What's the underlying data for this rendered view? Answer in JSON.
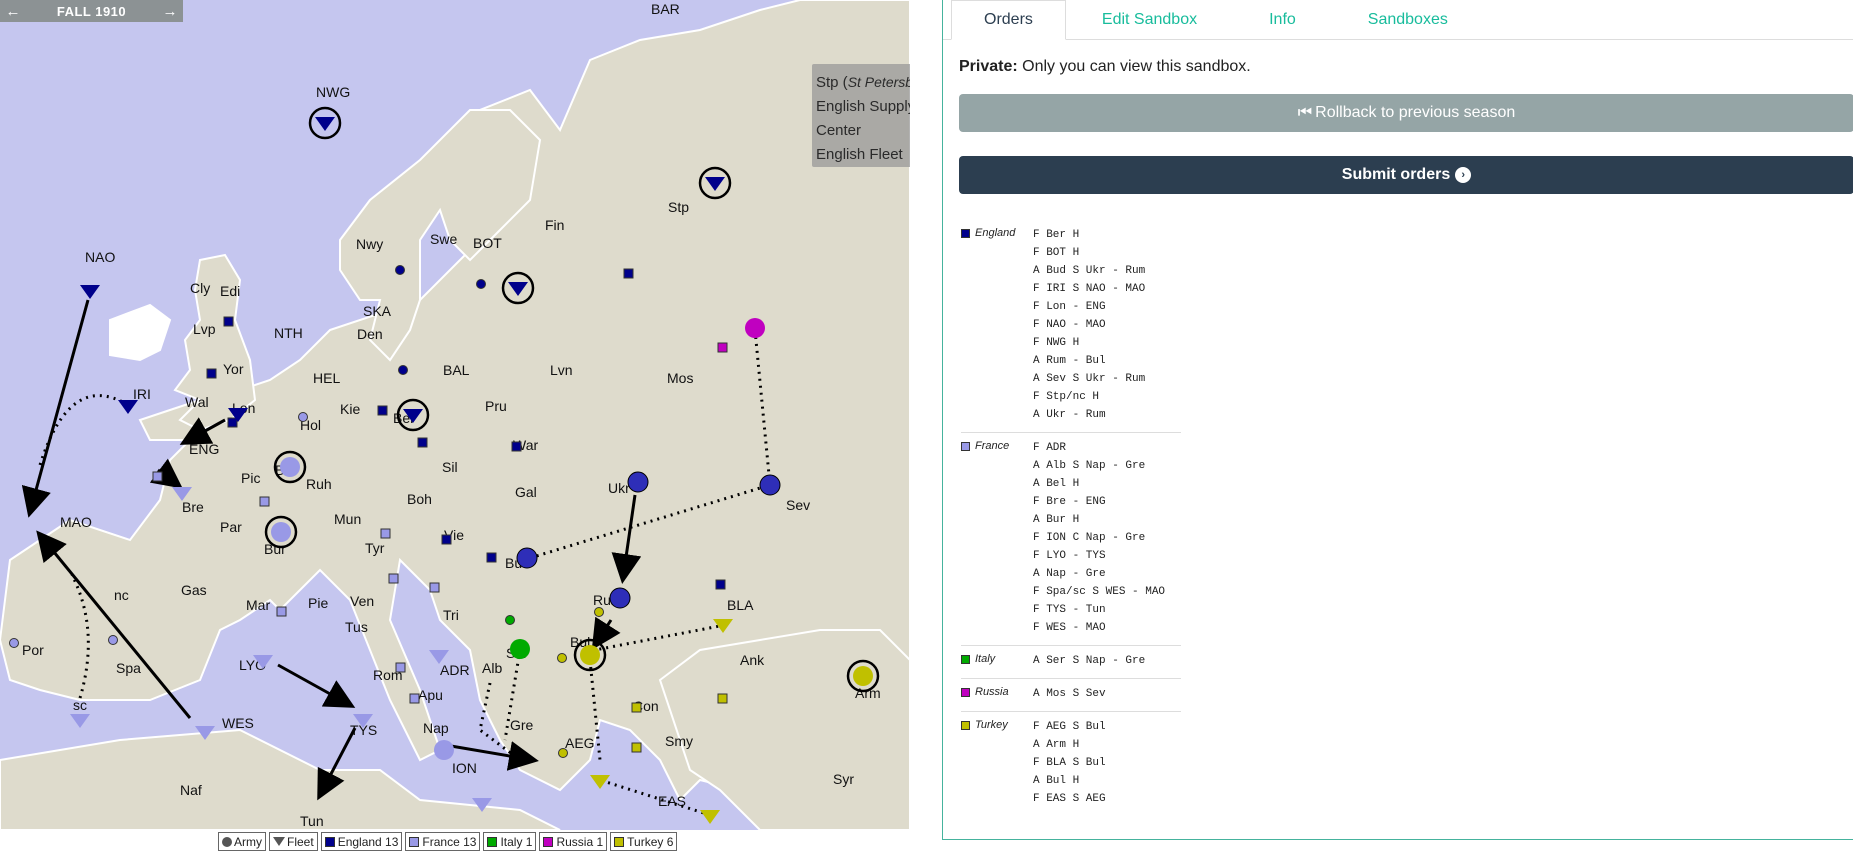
{
  "season": {
    "label": "FALL 1910",
    "prev_icon": "arrow-left-icon",
    "next_icon": "arrow-right-icon"
  },
  "tooltip": {
    "abbr": "Stp",
    "full": "St Petersburg",
    "line2": "English Supply",
    "line3": "Center",
    "line4": "English Fleet"
  },
  "territories": [
    "BAR",
    "NWG",
    "NAO",
    "Cly",
    "Edi",
    "Lvp",
    "NTH",
    "IRI",
    "Yor",
    "Wal",
    "Lon",
    "ENG",
    "MAO",
    "Bre",
    "Pic",
    "Par",
    "Bel",
    "Hol",
    "Ruh",
    "Bur",
    "Gas",
    "Spa",
    "nc",
    "sc",
    "Por",
    "Mar",
    "Pie",
    "Ven",
    "Tus",
    "Rom",
    "Apu",
    "Nap",
    "TYS",
    "LYO",
    "WES",
    "Naf",
    "Tun",
    "ION",
    "Alb",
    "Gre",
    "Ser",
    "Tri",
    "ADR",
    "Bud",
    "Vie",
    "Boh",
    "Mun",
    "Tyr",
    "Sil",
    "Gal",
    "Ukr",
    "Rum",
    "BLA",
    "Bul",
    "Con",
    "AEG",
    "Smy",
    "EAS",
    "Syr",
    "Ank",
    "Arm",
    "Sev",
    "Mos",
    "War",
    "Pru",
    "Lvn",
    "BAL",
    "Ber",
    "Kie",
    "Den",
    "SKA",
    "HEL",
    "Nwy",
    "Swe",
    "BOT",
    "Fin",
    "Stp"
  ],
  "colors": {
    "england": "#00008b",
    "france": "#9999e6",
    "italy": "#00aa00",
    "russia": "#c000c0",
    "turkey": "#c0c000",
    "sea": "#c5c6ef",
    "land": "#dedbcc"
  },
  "legend": {
    "army": "Army",
    "fleet": "Fleet",
    "england": "England 13",
    "france": "France 13",
    "italy": "Italy 1",
    "russia": "Russia 1",
    "turkey": "Turkey 6"
  },
  "tabs": [
    {
      "label": "Orders"
    },
    {
      "label": "Edit Sandbox"
    },
    {
      "label": "Info"
    },
    {
      "label": "Sandboxes"
    }
  ],
  "private": {
    "bold": "Private:",
    "text": "Only you can view this sandbox."
  },
  "buttons": {
    "rollback": "Rollback to previous season",
    "submit": "Submit orders"
  },
  "orders": [
    {
      "nation": "England",
      "color": "#00008b",
      "items": [
        "F Ber H",
        "F BOT H",
        "A Bud S Ukr - Rum",
        "F IRI S NAO - MAO",
        "F Lon - ENG",
        "F NAO - MAO",
        "F NWG H",
        "A Rum - Bul",
        "A Sev S Ukr - Rum",
        "F Stp/nc H",
        "A Ukr - Rum"
      ]
    },
    {
      "nation": "France",
      "color": "#9999e6",
      "items": [
        "F ADR",
        "A Alb S Nap - Gre",
        "A Bel H",
        "F Bre - ENG",
        "A Bur H",
        "F ION C Nap - Gre",
        "F LYO - TYS",
        "A Nap - Gre",
        "F Spa/sc S WES - MAO",
        "F TYS - Tun",
        "F WES - MAO"
      ]
    },
    {
      "nation": "Italy",
      "color": "#00aa00",
      "items": [
        "A Ser S Nap - Gre"
      ]
    },
    {
      "nation": "Russia",
      "color": "#c000c0",
      "items": [
        "A Mos S Sev"
      ]
    },
    {
      "nation": "Turkey",
      "color": "#c0c000",
      "items": [
        "F AEG S Bul",
        "A Arm H",
        "F BLA S Bul",
        "A Bul H",
        "F EAS S AEG"
      ]
    }
  ]
}
